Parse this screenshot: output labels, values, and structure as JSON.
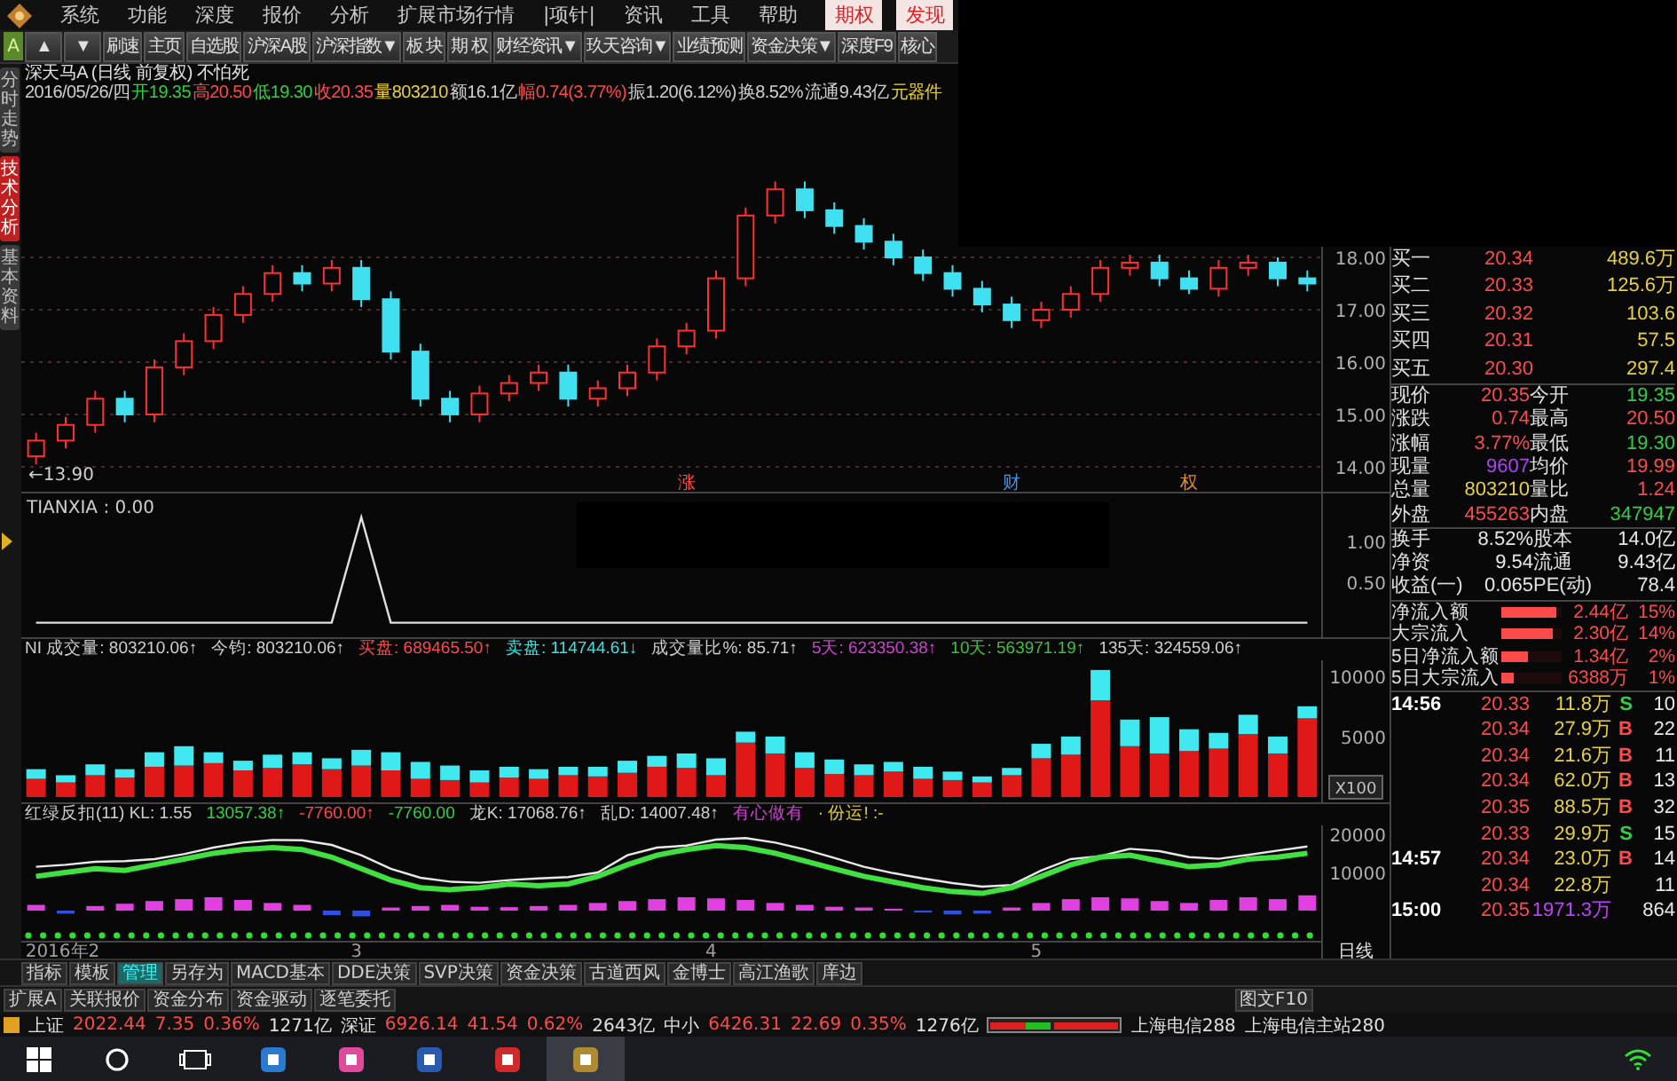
{
  "menu": {
    "items": [
      "系统",
      "功能",
      "深度",
      "报价",
      "分析",
      "扩展市场行情",
      "|项针|",
      "资讯",
      "工具",
      "帮助"
    ],
    "highlights": [
      "期权",
      "发现"
    ]
  },
  "toolbar": {
    "badge": "A",
    "buttons": [
      "▲",
      "▼",
      "刷速",
      "主页",
      "自选股",
      "沪深A股",
      "沪深指数▼",
      "板 块",
      "期 权",
      "财经资讯▼",
      "玖天咨询▼",
      "业绩预测",
      "资金决策▼",
      "深度F9",
      "核心"
    ]
  },
  "side_tabs": [
    {
      "label": "分时走势",
      "selected": false
    },
    {
      "label": "技术分析",
      "selected": true
    },
    {
      "label": "基本资料",
      "selected": false
    }
  ],
  "chart_header": {
    "title": "深天马A (日线 前复权) 不怕死",
    "info": [
      {
        "text": "2016/05/26/四",
        "color": "#d0d0d0"
      },
      {
        "text": "开19.35",
        "color": "#30d040"
      },
      {
        "text": "高20.50",
        "color": "#ff4a4a"
      },
      {
        "text": "低19.30",
        "color": "#30d040"
      },
      {
        "text": "收20.35",
        "color": "#ff4a4a"
      },
      {
        "text": "量803210",
        "color": "#e8d040"
      },
      {
        "text": "额16.1亿",
        "color": "#d0d0d0"
      },
      {
        "text": "幅0.74(3.77%)",
        "color": "#ff4a4a"
      },
      {
        "text": "振1.20(6.12%)",
        "color": "#d0d0d0"
      },
      {
        "text": "换8.52%",
        "color": "#d0d0d0"
      },
      {
        "text": "流通9.43亿",
        "color": "#d0d0d0"
      },
      {
        "text": "元器件",
        "color": "#e8d040"
      }
    ]
  },
  "price_chart": {
    "low_label": "←13.90",
    "event_markers": [
      {
        "label": "涨",
        "color": "#ff4a4a"
      },
      {
        "label": "财",
        "color": "#4a90e0"
      },
      {
        "label": "权",
        "color": "#e09030"
      }
    ],
    "chart_data": {
      "type": "candlestick",
      "grid": true,
      "ylim": [
        13.49,
        20.95
      ],
      "yticks": [
        {
          "value": 14,
          "label": "14.00"
        },
        {
          "value": 15,
          "label": "15.00"
        },
        {
          "value": 16,
          "label": "16.00"
        },
        {
          "value": 17,
          "label": "17.00"
        },
        {
          "value": 18,
          "label": "18.00"
        }
      ],
      "ohlc": [
        [
          14.2,
          14.65,
          14.05,
          14.5
        ],
        [
          14.5,
          14.95,
          14.35,
          14.8
        ],
        [
          14.8,
          15.45,
          14.65,
          15.3
        ],
        [
          15.3,
          15.45,
          14.85,
          15.0
        ],
        [
          15.0,
          16.05,
          14.85,
          15.9
        ],
        [
          15.9,
          16.55,
          15.75,
          16.4
        ],
        [
          16.4,
          17.05,
          16.25,
          16.9
        ],
        [
          16.9,
          17.45,
          16.75,
          17.3
        ],
        [
          17.3,
          17.85,
          17.15,
          17.7
        ],
        [
          17.7,
          17.85,
          17.35,
          17.5
        ],
        [
          17.5,
          17.95,
          17.35,
          17.8
        ],
        [
          17.8,
          17.95,
          17.05,
          17.2
        ],
        [
          17.2,
          17.35,
          16.05,
          16.2
        ],
        [
          16.2,
          16.35,
          15.15,
          15.3
        ],
        [
          15.3,
          15.45,
          14.85,
          15.0
        ],
        [
          15.0,
          15.55,
          14.85,
          15.4
        ],
        [
          15.4,
          15.75,
          15.25,
          15.6
        ],
        [
          15.6,
          15.95,
          15.45,
          15.8
        ],
        [
          15.8,
          15.95,
          15.15,
          15.3
        ],
        [
          15.3,
          15.65,
          15.15,
          15.5
        ],
        [
          15.5,
          15.95,
          15.35,
          15.8
        ],
        [
          15.8,
          16.45,
          15.65,
          16.3
        ],
        [
          16.3,
          16.75,
          16.15,
          16.6
        ],
        [
          16.6,
          17.75,
          16.45,
          17.6
        ],
        [
          17.6,
          18.95,
          17.45,
          18.8
        ],
        [
          18.8,
          19.45,
          18.65,
          19.3
        ],
        [
          19.3,
          19.45,
          18.75,
          18.9
        ],
        [
          18.9,
          19.05,
          18.45,
          18.6
        ],
        [
          18.6,
          18.75,
          18.15,
          18.3
        ],
        [
          18.3,
          18.45,
          17.85,
          18.0
        ],
        [
          18.0,
          18.15,
          17.55,
          17.7
        ],
        [
          17.7,
          17.85,
          17.25,
          17.4
        ],
        [
          17.4,
          17.55,
          16.95,
          17.1
        ],
        [
          17.1,
          17.25,
          16.65,
          16.8
        ],
        [
          16.8,
          17.15,
          16.65,
          17.0
        ],
        [
          17.0,
          17.45,
          16.85,
          17.3
        ],
        [
          17.3,
          17.95,
          17.15,
          17.8
        ],
        [
          17.8,
          18.05,
          17.65,
          17.9
        ],
        [
          17.9,
          18.05,
          17.45,
          17.6
        ],
        [
          17.6,
          17.75,
          17.3,
          17.4
        ],
        [
          17.4,
          17.95,
          17.25,
          17.8
        ],
        [
          17.8,
          18.05,
          17.65,
          17.9
        ],
        [
          17.9,
          18.0,
          17.45,
          17.6
        ],
        [
          17.6,
          17.75,
          17.35,
          17.5
        ]
      ]
    }
  },
  "tianxia": {
    "label": "TIANXIA : 0.00",
    "chart_data": {
      "type": "line",
      "ylim": [
        -0.2,
        1.59
      ],
      "yticks": [
        {
          "value": 0.5,
          "label": "0.50"
        },
        {
          "value": 1,
          "label": "1.00"
        }
      ],
      "series": [
        {
          "color": "#e0e0e0",
          "values": [
            0,
            0,
            0,
            0,
            0,
            0,
            0,
            0,
            0,
            0,
            0,
            1.3,
            0,
            0,
            0,
            0,
            0,
            0,
            0,
            0,
            0,
            0,
            0,
            0,
            0,
            0,
            0,
            0,
            0,
            0,
            0,
            0,
            0,
            0,
            0,
            0,
            0,
            0,
            0,
            0,
            0,
            0,
            0,
            0
          ]
        }
      ]
    }
  },
  "volume": {
    "header": [
      {
        "text": "NI 成交量: 803210.06↑",
        "color": "#d0d0d0"
      },
      {
        "text": "今钧: 803210.06↑",
        "color": "#d0d0d0"
      },
      {
        "text": "买盘: 689465.50↑",
        "color": "#ff4a4a"
      },
      {
        "text": "卖盘: 114744.61↓",
        "color": "#40e0e0"
      },
      {
        "text": "成交量比%: 85.71↑",
        "color": "#d0d0d0"
      },
      {
        "text": "5天: 623350.38↑",
        "color": "#d040d0"
      },
      {
        "text": "10天: 563971.19↑",
        "color": "#40c040"
      },
      {
        "text": "135天: 324559.06↑",
        "color": "#d0d0d0"
      }
    ],
    "unit": "X100",
    "chart_data": {
      "type": "bar",
      "stacked": true,
      "ylim": [
        -440,
        11300
      ],
      "yticks": [
        {
          "value": 5000,
          "label": "5000"
        },
        {
          "value": 10000,
          "label": "10000"
        }
      ],
      "series": [
        {
          "color": "#e01818",
          "values": [
            1500,
            1200,
            1800,
            1600,
            2500,
            2600,
            2800,
            2200,
            2400,
            2700,
            2300,
            2600,
            2200,
            1500,
            1400,
            1200,
            1600,
            1500,
            1800,
            1700,
            2000,
            2500,
            2400,
            1800,
            4500,
            3600,
            2400,
            1900,
            1800,
            2100,
            1500,
            1400,
            1200,
            1800,
            3200,
            3500,
            8000,
            4200,
            3600,
            3800,
            4000,
            5200,
            3600,
            6500
          ]
        },
        {
          "color": "#40e8f0",
          "values": [
            800,
            600,
            900,
            700,
            1200,
            1600,
            900,
            800,
            1100,
            1000,
            900,
            1300,
            1500,
            1400,
            1200,
            1000,
            900,
            800,
            700,
            800,
            1000,
            900,
            1200,
            1400,
            900,
            1400,
            1300,
            1200,
            900,
            800,
            1000,
            700,
            500,
            600,
            1200,
            1500,
            2500,
            2200,
            3000,
            1800,
            1300,
            1600,
            1400,
            1000
          ]
        }
      ]
    }
  },
  "indicator": {
    "header": [
      {
        "text": "红绿反扣(11) KL: 1.55",
        "color": "#d0d0d0"
      },
      {
        "text": "13057.38↑",
        "color": "#30d040"
      },
      {
        "text": "-7760.00↑",
        "color": "#ff4a4a"
      },
      {
        "text": "-7760.00",
        "color": "#30d040"
      },
      {
        "text": "龙K: 17068.76↑",
        "color": "#d0d0d0"
      },
      {
        "text": "乱D: 14007.48↑",
        "color": "#d0d0d0"
      },
      {
        "text": "有心做有",
        "color": "#d040d0"
      },
      {
        "text": "· 份运! :-",
        "color": "#e8d040"
      }
    ],
    "x_axis_labels": [
      "2016年2",
      "3",
      "4",
      "5"
    ],
    "chart_data": {
      "type": "line",
      "ylim": [
        -5580,
        22325
      ],
      "yticks": [
        {
          "value": 10000,
          "label": "10000"
        },
        {
          "value": 20000,
          "label": "20000"
        }
      ],
      "series": [
        {
          "type": "bar",
          "color": "#e040e0",
          "values": [
            1500,
            null,
            1200,
            1800,
            2500,
            3000,
            3500,
            2800,
            2000,
            1500,
            null,
            null,
            800,
            1200,
            1500,
            1000,
            900,
            1200,
            1500,
            2000,
            2500,
            3000,
            3500,
            3200,
            2800,
            2000,
            1500,
            1000,
            800,
            500,
            null,
            null,
            null,
            800,
            2000,
            3000,
            3500,
            3200,
            2500,
            2000,
            2800,
            3500,
            3000,
            4000
          ]
        },
        {
          "type": "bar",
          "color": "#3050e0",
          "values": [
            null,
            -800,
            null,
            null,
            null,
            null,
            null,
            null,
            null,
            null,
            -1200,
            -1500,
            null,
            null,
            null,
            null,
            null,
            null,
            null,
            null,
            null,
            null,
            null,
            null,
            null,
            null,
            null,
            null,
            null,
            null,
            -500,
            -1000,
            -800,
            null,
            null,
            null,
            null,
            null,
            null,
            null,
            null,
            null,
            null,
            null
          ]
        },
        {
          "type": "line",
          "color": "#e8e8e8",
          "values": [
            11500,
            12000,
            12800,
            13000,
            13500,
            14800,
            16500,
            17800,
            18500,
            18400,
            17200,
            14500,
            11000,
            8600,
            7600,
            7300,
            8000,
            8400,
            8800,
            10000,
            14500,
            16500,
            17000,
            18600,
            19000,
            17800,
            16000,
            13800,
            11500,
            9800,
            8400,
            7200,
            6300,
            6700,
            10500,
            13500,
            14300,
            16200,
            15600,
            14000,
            13600,
            14600,
            15700,
            16800
          ]
        },
        {
          "type": "line",
          "color": "#40e040",
          "values": [
            9000,
            10000,
            11000,
            10500,
            12000,
            13500,
            15000,
            16000,
            16500,
            16000,
            14000,
            11000,
            8000,
            6000,
            5500,
            6000,
            7000,
            6500,
            7000,
            9000,
            12000,
            14500,
            16000,
            17000,
            16500,
            15000,
            13000,
            11000,
            9000,
            7500,
            6000,
            5000,
            4500,
            6000,
            9000,
            12000,
            14000,
            14500,
            13000,
            11500,
            12000,
            13500,
            14000,
            15000
          ]
        }
      ]
    }
  },
  "period_label": "日线",
  "order_book": [
    {
      "label": "买一",
      "price": "20.34",
      "volume": "489.6万"
    },
    {
      "label": "买二",
      "price": "20.33",
      "volume": "125.6万"
    },
    {
      "label": "买三",
      "price": "20.32",
      "volume": "103.6"
    },
    {
      "label": "买四",
      "price": "20.31",
      "volume": "57.5"
    },
    {
      "label": "买五",
      "price": "20.30",
      "volume": "297.4"
    }
  ],
  "quote": [
    {
      "label": "现价",
      "value": "20.35",
      "color": "#ff4a4a"
    },
    {
      "label": "今开",
      "value": "19.35",
      "color": "#30d040"
    },
    {
      "label": "涨跌",
      "value": "0.74",
      "color": "#ff4a4a"
    },
    {
      "label": "最高",
      "value": "20.50",
      "color": "#ff4a4a"
    },
    {
      "label": "涨幅",
      "value": "3.77%",
      "color": "#ff4a4a"
    },
    {
      "label": "最低",
      "value": "19.30",
      "color": "#30d040"
    },
    {
      "label": "现量",
      "value": "9607",
      "color": "#b040ff"
    },
    {
      "label": "均价",
      "value": "19.99",
      "color": "#ff4a4a"
    },
    {
      "label": "总量",
      "value": "803210",
      "color": "#e8d040"
    },
    {
      "label": "量比",
      "value": "1.24",
      "color": "#ff4a4a"
    },
    {
      "label": "外盘",
      "value": "455263",
      "color": "#ff4a4a"
    },
    {
      "label": "内盘",
      "value": "347947",
      "color": "#30d040"
    }
  ],
  "fundamentals": [
    {
      "label": "换手",
      "value": "8.52%"
    },
    {
      "label": "股本",
      "value": "14.0亿"
    },
    {
      "label": "净资",
      "value": "9.54"
    },
    {
      "label": "流通",
      "value": "9.43亿"
    },
    {
      "label": "收益(一)",
      "value": "0.065"
    },
    {
      "label": "PE(动)",
      "value": "78.4"
    }
  ],
  "fund_flow": [
    {
      "label": "净流入额",
      "level": 0.9,
      "value": "2.44亿",
      "pct": "15%"
    },
    {
      "label": "大宗流入",
      "level": 0.85,
      "value": "2.30亿",
      "pct": "14%"
    },
    {
      "label": "5日净流入额",
      "level": 0.45,
      "value": "1.34亿",
      "pct": "2%"
    },
    {
      "label": "5日大宗流入",
      "level": 0.2,
      "value": "6388万",
      "pct": "1%"
    }
  ],
  "ticks": [
    {
      "time": "14:56",
      "price": "20.33",
      "volume": "11.8万",
      "side": "S",
      "color": "#30d040",
      "large": false,
      "count": "10"
    },
    {
      "price": "20.34",
      "volume": "27.9万",
      "side": "B",
      "color": "#ff4a4a",
      "large": false,
      "count": "22"
    },
    {
      "price": "20.34",
      "volume": "21.6万",
      "side": "B",
      "color": "#ff4a4a",
      "large": false,
      "count": "11"
    },
    {
      "price": "20.34",
      "volume": "62.0万",
      "side": "B",
      "color": "#ff4a4a",
      "large": false,
      "count": "13"
    },
    {
      "price": "20.35",
      "volume": "88.5万",
      "side": "B",
      "color": "#ff4a4a",
      "large": false,
      "count": "32"
    },
    {
      "price": "20.33",
      "volume": "29.9万",
      "side": "S",
      "color": "#30d040",
      "large": false,
      "count": "15"
    },
    {
      "time": "14:57",
      "price": "20.34",
      "volume": "23.0万",
      "side": "B",
      "color": "#ff4a4a",
      "large": false,
      "count": "14"
    },
    {
      "price": "20.34",
      "volume": "22.8万",
      "large": false,
      "count": "11"
    },
    {
      "time": "15:00",
      "price": "20.35",
      "volume": "1971.3万",
      "large": true,
      "count": "864"
    }
  ],
  "bottom_tabs": [
    {
      "label": "指标",
      "selected": false
    },
    {
      "label": "模板",
      "selected": false
    },
    {
      "label": "管理",
      "selected": true
    },
    {
      "label": "另存为",
      "selected": false
    },
    {
      "label": "MACD基本",
      "selected": false
    },
    {
      "label": "DDE决策",
      "selected": false
    },
    {
      "label": "SVP决策",
      "selected": false
    },
    {
      "label": "资金决策",
      "selected": false
    },
    {
      "label": "古道西风",
      "selected": false
    },
    {
      "label": "金博士",
      "selected": false
    },
    {
      "label": "高江渔歌",
      "selected": false
    },
    {
      "label": "庠边",
      "selected": false
    }
  ],
  "sub_tabs": [
    "扩展A",
    "关联报价",
    "资金分布",
    "资金驱动",
    "逐笔委托"
  ],
  "f10_button": "图文F10",
  "status_bar": [
    {
      "text": "上证",
      "color": "#e0e0e0"
    },
    {
      "text": "2022.44",
      "color": "#ff4a4a"
    },
    {
      "text": "7.35",
      "color": "#ff4a4a"
    },
    {
      "text": "0.36%",
      "color": "#ff4a4a"
    },
    {
      "text": "1271亿",
      "color": "#e0e0e0"
    },
    {
      "text": "深证",
      "color": "#e0e0e0"
    },
    {
      "text": "6926.14",
      "color": "#ff4a4a"
    },
    {
      "text": "41.54",
      "color": "#ff4a4a"
    },
    {
      "text": "0.62%",
      "color": "#ff4a4a"
    },
    {
      "text": "2643亿",
      "color": "#e0e0e0"
    },
    {
      "text": "中小",
      "color": "#e0e0e0"
    },
    {
      "text": "6426.31",
      "color": "#ff4a4a"
    },
    {
      "text": "22.69",
      "color": "#ff4a4a"
    },
    {
      "text": "0.35%",
      "color": "#ff4a4a"
    },
    {
      "text": "1276亿",
      "color": "#e0e0e0"
    }
  ],
  "servers": [
    "上海电信288",
    "上海电信主站280"
  ],
  "taskbar": {
    "apps": [
      {
        "color": "#2a7ad0",
        "selected": false
      },
      {
        "color": "#e04a9a",
        "selected": false
      },
      {
        "color": "#2a5ab0",
        "selected": false
      },
      {
        "color": "#d02a2a",
        "selected": false
      },
      {
        "color": "#b08a30",
        "selected": true
      }
    ]
  }
}
